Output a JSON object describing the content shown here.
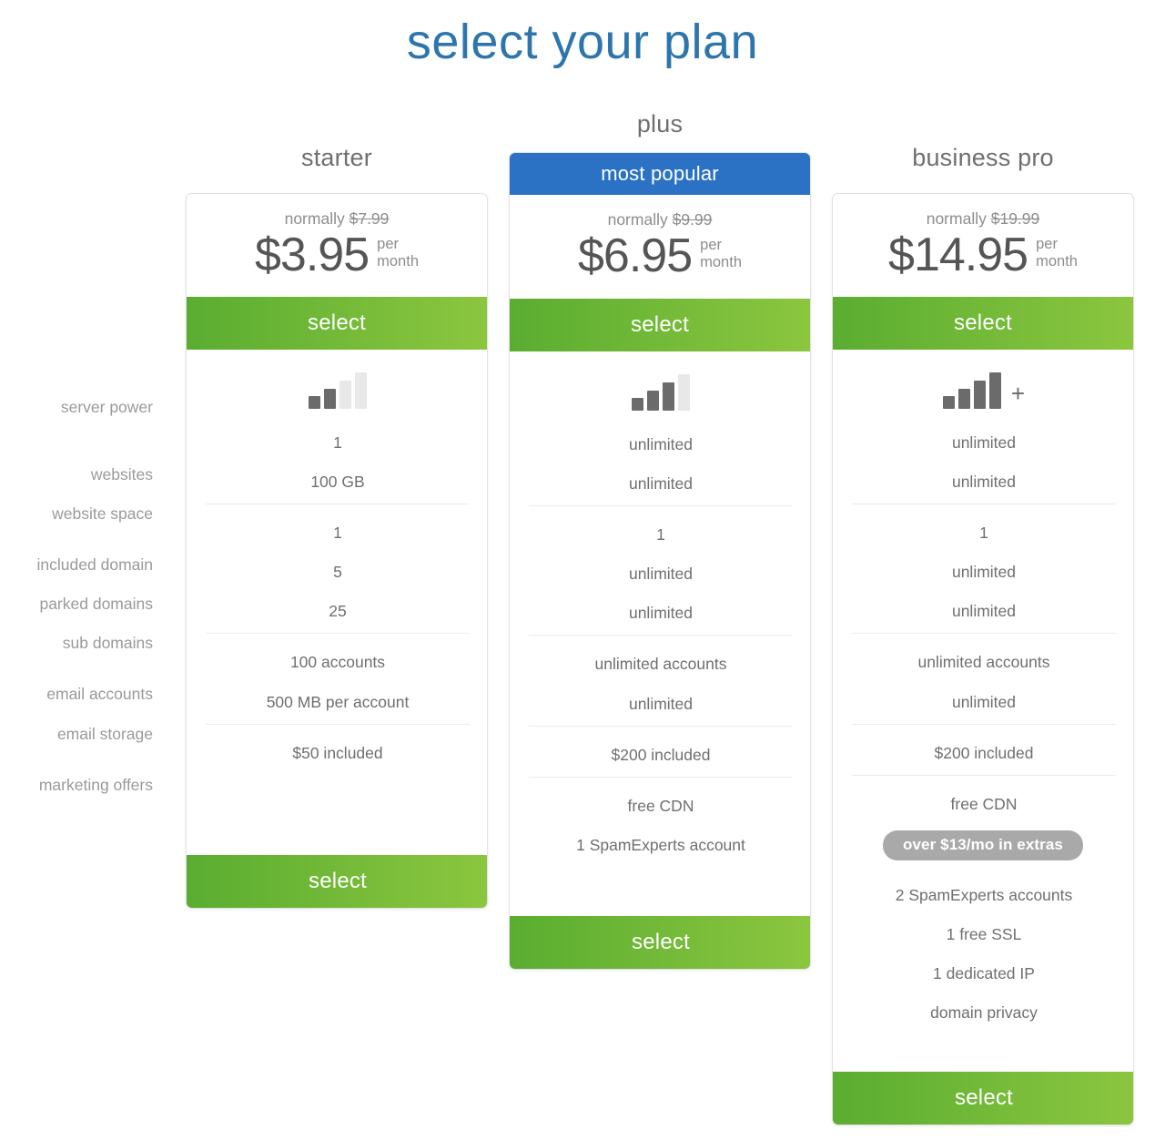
{
  "page": {
    "title": "select your plan"
  },
  "feature_labels": [
    {
      "key": "server_power",
      "label": "server power"
    },
    {
      "key": "websites",
      "label": "websites"
    },
    {
      "key": "website_space",
      "label": "website space"
    },
    {
      "key": "included_domain",
      "label": "included domain"
    },
    {
      "key": "parked_domains",
      "label": "parked domains"
    },
    {
      "key": "sub_domains",
      "label": "sub domains"
    },
    {
      "key": "email_accounts",
      "label": "email accounts"
    },
    {
      "key": "email_storage",
      "label": "email storage"
    },
    {
      "key": "marketing_offers",
      "label": "marketing offers"
    }
  ],
  "colors": {
    "title_blue": "#2d76ad",
    "banner_blue": "#2c72c4",
    "select_green_dark": "#5aad31",
    "select_green_light": "#8cc63f",
    "pill_gray": "#a9a9a9",
    "text_gray": "#6f6f6f",
    "label_gray": "#9a9a9a"
  },
  "plans": [
    {
      "id": "starter",
      "name": "starter",
      "badge": null,
      "normally_prefix": "normally",
      "normally_price": "$7.99",
      "price": "$3.95",
      "per": "per\nmonth",
      "select_top_label": "select",
      "select_bottom_label": "select",
      "server_power": {
        "icon": "signal-bars-icon",
        "filled": 2,
        "total": 4,
        "plus": false
      },
      "websites": "1",
      "website_space": "100 GB",
      "included_domain": "1",
      "parked_domains": "5",
      "sub_domains": "25",
      "email_accounts": "100 accounts",
      "email_storage": "500 MB per account",
      "marketing_offers": "$50 included",
      "extras": []
    },
    {
      "id": "plus",
      "name": "plus",
      "badge": "most popular",
      "normally_prefix": "normally",
      "normally_price": "$9.99",
      "price": "$6.95",
      "per": "per\nmonth",
      "select_top_label": "select",
      "select_bottom_label": "select",
      "server_power": {
        "icon": "signal-bars-icon",
        "filled": 3,
        "total": 4,
        "plus": false
      },
      "websites": "unlimited",
      "website_space": "unlimited",
      "included_domain": "1",
      "parked_domains": "unlimited",
      "sub_domains": "unlimited",
      "email_accounts": "unlimited accounts",
      "email_storage": "unlimited",
      "marketing_offers": "$200 included",
      "extras": [
        {
          "type": "text",
          "value": "free CDN"
        },
        {
          "type": "text",
          "value": "1 SpamExperts account"
        }
      ]
    },
    {
      "id": "business_pro",
      "name": "business pro",
      "badge": null,
      "normally_prefix": "normally",
      "normally_price": "$19.99",
      "price": "$14.95",
      "per": "per\nmonth",
      "select_top_label": "select",
      "select_bottom_label": "select",
      "server_power": {
        "icon": "signal-bars-icon",
        "filled": 4,
        "total": 4,
        "plus": true
      },
      "websites": "unlimited",
      "website_space": "unlimited",
      "included_domain": "1",
      "parked_domains": "unlimited",
      "sub_domains": "unlimited",
      "email_accounts": "unlimited accounts",
      "email_storage": "unlimited",
      "marketing_offers": "$200 included",
      "extras": [
        {
          "type": "text",
          "value": "free CDN"
        },
        {
          "type": "pill",
          "value": "over $13/mo in extras"
        },
        {
          "type": "text",
          "value": "2 SpamExperts accounts"
        },
        {
          "type": "text",
          "value": "1 free SSL"
        },
        {
          "type": "text",
          "value": "1 dedicated IP"
        },
        {
          "type": "text",
          "value": "domain privacy"
        }
      ]
    }
  ]
}
